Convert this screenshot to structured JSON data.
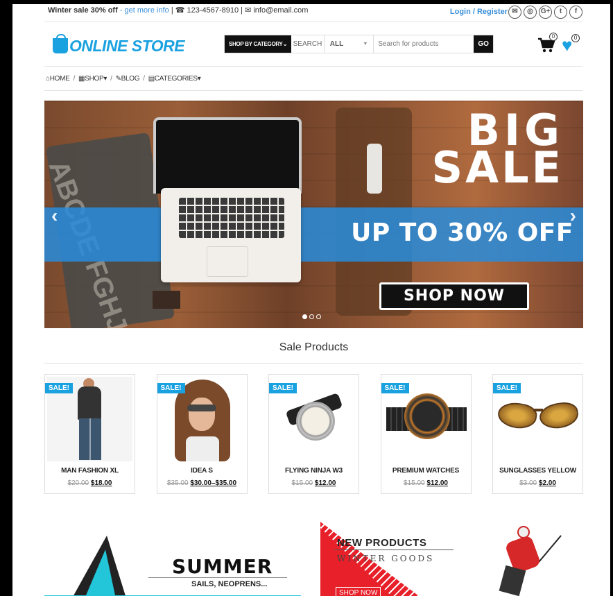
{
  "topbar": {
    "promo_bold": "Winter sale 30% off",
    "promo_link": "- get more info",
    "promo_rest": "| ☎ 123-4567-8910 | ✉ info@email.com",
    "login": "Login / Register",
    "socials": [
      "✉",
      "◎",
      "G+",
      "t",
      "f"
    ]
  },
  "header": {
    "logo_first": "ONLINE",
    "logo_second": "STORE",
    "shop_by_category": "SHOP BY CATEGORY",
    "search_label": "SEARCH",
    "category_select": "ALL",
    "search_placeholder": "Search for products",
    "go": "GO",
    "cart_count": "0",
    "wishlist_count": "0"
  },
  "nav": {
    "home": "HOME",
    "shop": "SHOP",
    "blog": "BLOG",
    "categories": "CATEGORIES"
  },
  "banner": {
    "line1": "BIG",
    "line2": "SALE",
    "offer": "UP TO 30% OFF",
    "cta": "SHOP NOW",
    "slides": 3,
    "active_slide": 1
  },
  "sale_section": {
    "title": "Sale Products",
    "badge": "SALE!",
    "products": [
      {
        "name": "MAN FASHION XL",
        "old": "$20.00",
        "new": "$18.00"
      },
      {
        "name": "IDEA S",
        "old": "$35.00",
        "new": "$30.00–$35.00"
      },
      {
        "name": "FLYING NINJA W3",
        "old": "$15.00",
        "new": "$12.00"
      },
      {
        "name": "PREMIUM WATCHES",
        "old": "$15.00",
        "new": "$12.00"
      },
      {
        "name": "SUNGLASSES YELLOW",
        "old": "$3.00",
        "new": "$2.00"
      }
    ]
  },
  "promos": {
    "summer_title": "SUMMER",
    "summer_sub": "SAILS, NEOPRENS...",
    "new_title": "NEW PRODUCTS",
    "new_sub": "WINTER GOODS",
    "new_cta": "SHOP NOW"
  },
  "colors": {
    "accent": "#1aa1e0",
    "dark": "#111111",
    "promo_red": "#e8202a"
  }
}
